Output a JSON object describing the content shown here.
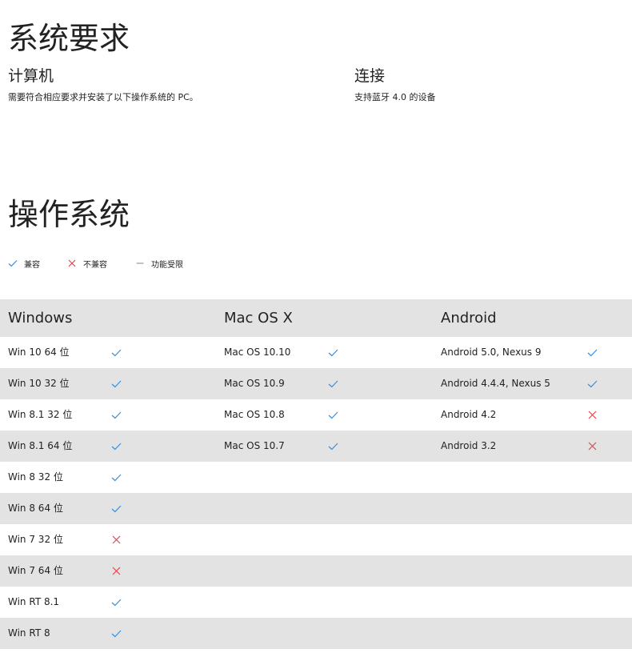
{
  "requirements": {
    "title": "系统要求",
    "computer": {
      "title": "计算机",
      "description": "需要符合相应要求并安装了以下操作系统的 PC。"
    },
    "connection": {
      "title": "连接",
      "description": "支持蓝牙 4.0 的设备"
    }
  },
  "os": {
    "title": "操作系统",
    "legend": {
      "compatible": "兼容",
      "incompatible": "不兼容",
      "limited": "功能受限"
    },
    "columns": {
      "windows": "Windows",
      "mac": "Mac OS X",
      "android": "Android"
    },
    "rows": [
      {
        "win": "Win 10 64 位",
        "win_status": "compatible",
        "mac": "Mac OS 10.10",
        "mac_status": "compatible",
        "and": "Android 5.0, Nexus 9",
        "and_status": "compatible"
      },
      {
        "win": "Win 10 32 位",
        "win_status": "compatible",
        "mac": "Mac OS 10.9",
        "mac_status": "compatible",
        "and": "Android 4.4.4, Nexus 5",
        "and_status": "compatible"
      },
      {
        "win": "Win 8.1 32 位",
        "win_status": "compatible",
        "mac": "Mac OS 10.8",
        "mac_status": "compatible",
        "and": "Android 4.2",
        "and_status": "incompatible"
      },
      {
        "win": "Win 8.1 64 位",
        "win_status": "compatible",
        "mac": "Mac OS 10.7",
        "mac_status": "compatible",
        "and": "Android 3.2",
        "and_status": "incompatible"
      },
      {
        "win": "Win 8 32 位",
        "win_status": "compatible"
      },
      {
        "win": "Win 8 64 位",
        "win_status": "compatible"
      },
      {
        "win": "Win 7 32 位",
        "win_status": "incompatible"
      },
      {
        "win": "Win 7 64 位",
        "win_status": "incompatible"
      },
      {
        "win": "Win RT 8.1",
        "win_status": "compatible"
      },
      {
        "win": "Win RT 8",
        "win_status": "compatible"
      }
    ]
  },
  "colors": {
    "check": "#3b8fd9",
    "cross": "#e0474c",
    "dash": "#999999",
    "stripe": "#e3e3e3",
    "text": "#222222"
  }
}
